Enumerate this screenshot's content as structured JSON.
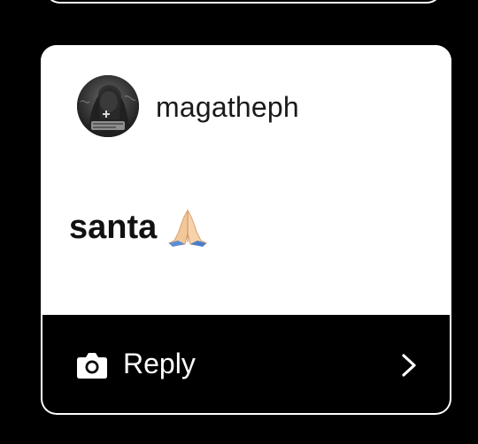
{
  "story_reply": {
    "username": "magatheph",
    "comment_text": "santa",
    "comment_emoji": "folded-hands-icon",
    "reply_label": "Reply"
  },
  "icons": {
    "camera": "camera-icon",
    "chevron": "chevron-right-icon",
    "avatar": "avatar"
  },
  "colors": {
    "background": "#000000",
    "card": "#ffffff",
    "text_dark": "#111111",
    "text_light": "#ffffff"
  }
}
